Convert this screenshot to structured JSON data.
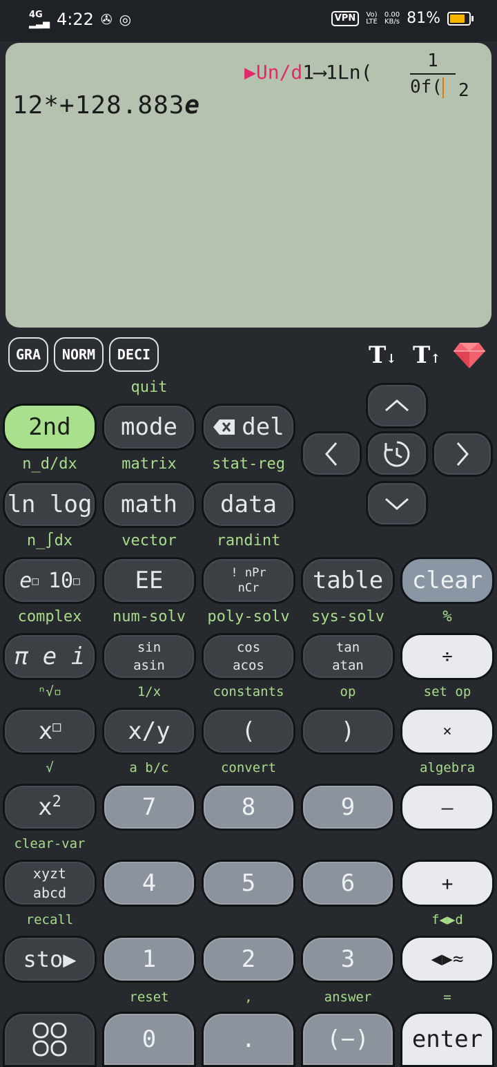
{
  "status": {
    "network": "4G",
    "time": "4:22",
    "vpn": "VPN",
    "volte_top": "Vo)",
    "volte_bottom": "LTE",
    "speed_top": "0.00",
    "speed_bottom": "KB/s",
    "battery": "81%",
    "battery_level": 0.81
  },
  "display": {
    "top_pink": "▶Un/d",
    "top_rest": "1⟶1Ln(",
    "frac_num": "1",
    "frac_den": "0f(",
    "frac_exp": "2",
    "main_prefix": "12*+128.883",
    "main_e": "e"
  },
  "modes": {
    "gra": "GRA",
    "norm": "NORM",
    "deci": "DECI"
  },
  "labels": {
    "quit": "quit",
    "n_d_dx": "n_d/dx",
    "matrix": "matrix",
    "stat_reg": "stat-reg",
    "n_int_dx": "n_∫dx",
    "vector": "vector",
    "randint": "randint",
    "complex": "complex",
    "num_solv": "num-solv",
    "poly_solv": "poly-solv",
    "sys_solv": "sys-solv",
    "percent": "%",
    "root_n": "ⁿ√▫",
    "inv_x": "1/x",
    "constants": "constants",
    "op": "op",
    "set_op": "set op",
    "sqrt": "√",
    "a_bc": "a b/c",
    "convert": "convert",
    "algebra": "algebra",
    "clear_var": "clear-var",
    "recall": "recall",
    "f_d": "f◀▶d",
    "reset": "reset",
    "comma": ",",
    "answer": "answer",
    "equals": "="
  },
  "keys": {
    "second": "2nd",
    "mode": "mode",
    "del": "del",
    "ln_log": "ln log",
    "math": "math",
    "data": "data",
    "e_pow": "e",
    "ten_pow": "10",
    "ee": "EE",
    "fact_top": "! nPr",
    "fact_bottom": "nCr",
    "table": "table",
    "clear": "clear",
    "pi_e_i": "π e i",
    "sin": "sin",
    "asin": "asin",
    "cos": "cos",
    "acos": "acos",
    "tan": "tan",
    "atan": "atan",
    "divide": "÷",
    "x_pow": "x",
    "x_over_y": "x/y",
    "lparen": "(",
    "rparen": ")",
    "multiply": "×",
    "x_sq": "x",
    "seven": "7",
    "eight": "8",
    "nine": "9",
    "minus": "—",
    "vars_top": "xyzt",
    "vars_bottom": "abcd",
    "four": "4",
    "five": "5",
    "six": "6",
    "plus": "+",
    "sto": "sto▶",
    "one": "1",
    "two": "2",
    "three": "3",
    "approx": "◀▶≈",
    "zero": "0",
    "dot": ".",
    "negate": "(−)",
    "enter": "enter"
  }
}
